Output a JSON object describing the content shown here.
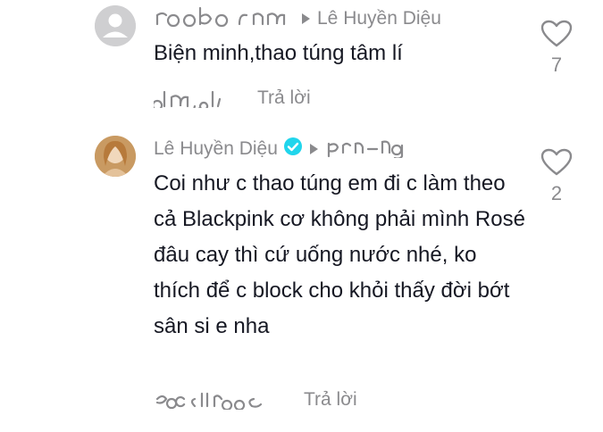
{
  "comments": [
    {
      "reply_to": "Lê Huyền Diệu",
      "text": "Biện minh,thao túng tâm lí",
      "reply_label": "Trả lời",
      "likes": "7"
    },
    {
      "author": "Lê Huyền Diệu",
      "text": "Coi như c thao túng em đi c làm theo cả Blackpink cơ không phải mình Rosé đâu cay thì cứ uống nước nhé, ko thích để c block cho khỏi thấy đời bớt sân si e nha",
      "reply_label": "Trả lời",
      "likes": "2"
    }
  ],
  "colors": {
    "text": "#161823",
    "secondary": "#8a8a8d",
    "verified": "#20d5ec",
    "avatar_default": "#cfcfd1"
  },
  "icons": [
    "user-avatar-icon",
    "reply-arrow-icon",
    "verified-badge-icon",
    "heart-outline-icon"
  ]
}
